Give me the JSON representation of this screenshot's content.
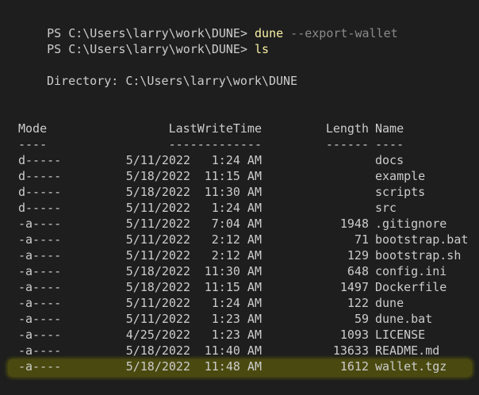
{
  "prompts": [
    {
      "prompt": "PS C:\\Users\\larry\\work\\DUNE> ",
      "command": "dune",
      "args": " --export-wallet"
    },
    {
      "prompt": "PS C:\\Users\\larry\\work\\DUNE> ",
      "command": "ls",
      "args": ""
    }
  ],
  "directory_line": "Directory: C:\\Users\\larry\\work\\DUNE",
  "headers": {
    "mode": "Mode",
    "lastwritetime": "LastWriteTime",
    "length": "Length",
    "name": "Name"
  },
  "separators": {
    "mode": "----",
    "lastwritetime": "-------------",
    "length": "------",
    "name": "----"
  },
  "rows": [
    {
      "mode": "d-----",
      "date": "5/11/2022",
      "time": "1:24 AM",
      "length": "",
      "name": "docs"
    },
    {
      "mode": "d-----",
      "date": "5/18/2022",
      "time": "11:15 AM",
      "length": "",
      "name": "example"
    },
    {
      "mode": "d-----",
      "date": "5/18/2022",
      "time": "11:30 AM",
      "length": "",
      "name": "scripts"
    },
    {
      "mode": "d-----",
      "date": "5/11/2022",
      "time": "1:24 AM",
      "length": "",
      "name": "src"
    },
    {
      "mode": "-a----",
      "date": "5/11/2022",
      "time": "7:04 AM",
      "length": "1948",
      "name": ".gitignore"
    },
    {
      "mode": "-a----",
      "date": "5/11/2022",
      "time": "2:12 AM",
      "length": "71",
      "name": "bootstrap.bat"
    },
    {
      "mode": "-a----",
      "date": "5/11/2022",
      "time": "2:12 AM",
      "length": "129",
      "name": "bootstrap.sh"
    },
    {
      "mode": "-a----",
      "date": "5/18/2022",
      "time": "11:30 AM",
      "length": "648",
      "name": "config.ini"
    },
    {
      "mode": "-a----",
      "date": "5/18/2022",
      "time": "11:15 AM",
      "length": "1497",
      "name": "Dockerfile"
    },
    {
      "mode": "-a----",
      "date": "5/11/2022",
      "time": "1:24 AM",
      "length": "122",
      "name": "dune"
    },
    {
      "mode": "-a----",
      "date": "5/11/2022",
      "time": "1:23 AM",
      "length": "59",
      "name": "dune.bat"
    },
    {
      "mode": "-a----",
      "date": "4/25/2022",
      "time": "1:23 AM",
      "length": "1093",
      "name": "LICENSE"
    },
    {
      "mode": "-a----",
      "date": "5/18/2022",
      "time": "11:40 AM",
      "length": "13633",
      "name": "README.md"
    },
    {
      "mode": "-a----",
      "date": "5/18/2022",
      "time": "11:48 AM",
      "length": "1612",
      "name": "wallet.tgz",
      "highlighted": true
    }
  ]
}
